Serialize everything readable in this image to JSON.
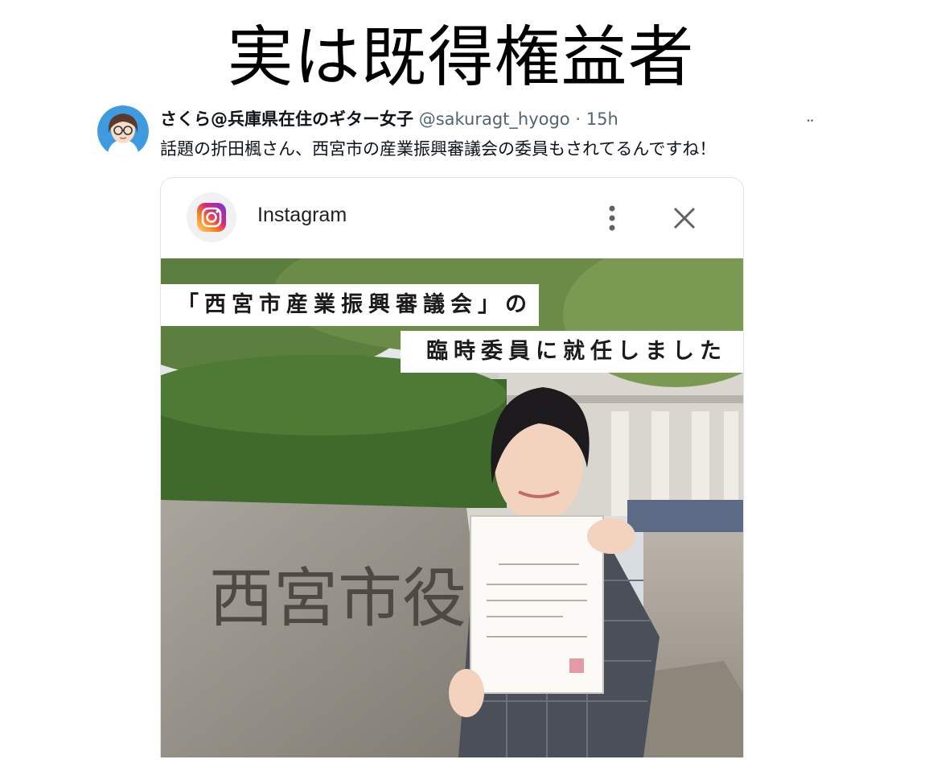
{
  "headline": "実は既得権益者",
  "tweet": {
    "author_name": "さくら@兵庫県在住のギター女子",
    "handle": "@sakuragt_hyogo",
    "separator": "·",
    "time": "15h",
    "more": "··",
    "text": "話題の折田楓さん、西宮市の産業振興審議会の委員もされてるんですね！"
  },
  "embed": {
    "app_name": "Instagram",
    "menu_icon": "kebab-icon",
    "close_icon": "close-icon",
    "caption_line1": "「西宮市産業振興審議会」の",
    "caption_line2": "臨時委員に就任しました",
    "stone_text": "西宮市役"
  },
  "colors": {
    "text_primary": "#0f1419",
    "text_secondary": "#536471",
    "card_border": "#dfe3e6"
  }
}
